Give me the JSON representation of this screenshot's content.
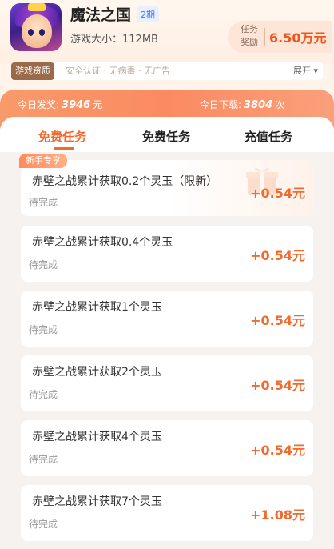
{
  "game": {
    "title": "魔法之国",
    "issue": "2期",
    "size_label": "游戏大小：112MB"
  },
  "reward": {
    "label": "任务奖励",
    "amount": "6.50万元"
  },
  "qualification": {
    "tag": "游戏资质",
    "text": "安全认证 · 无病毒 · 无广告",
    "expand": "展开 ▾"
  },
  "stats": {
    "today_payout_label": "今日发奖:",
    "today_payout_value": "3946",
    "today_payout_unit": "元",
    "today_download_label": "今日下载:",
    "today_download_value": "3804",
    "today_download_unit": "次"
  },
  "tabs": [
    {
      "label": "免费任务",
      "active": true
    },
    {
      "label": "免费任务",
      "active": false
    },
    {
      "label": "充值任务",
      "active": false
    }
  ],
  "newbie_tag": "新手专享",
  "tasks": [
    {
      "title": "赤壁之战累计获取0.2个灵玉（限新）",
      "status": "待完成",
      "reward": "+0.54元"
    },
    {
      "title": "赤壁之战累计获取0.4个灵玉",
      "status": "待完成",
      "reward": "+0.54元"
    },
    {
      "title": "赤壁之战累计获取1个灵玉",
      "status": "待完成",
      "reward": "+0.54元"
    },
    {
      "title": "赤壁之战累计获取2个灵玉",
      "status": "待完成",
      "reward": "+0.54元"
    },
    {
      "title": "赤壁之战累计获取4个灵玉",
      "status": "待完成",
      "reward": "+0.54元"
    },
    {
      "title": "赤壁之战累计获取7个灵玉",
      "status": "待完成",
      "reward": "+1.08元"
    }
  ],
  "colors": {
    "accent": "#f36a2e",
    "reward_red": "#f0551e",
    "qual_tag": "#9a6b4a",
    "issue_badge": "#4a78f0"
  }
}
